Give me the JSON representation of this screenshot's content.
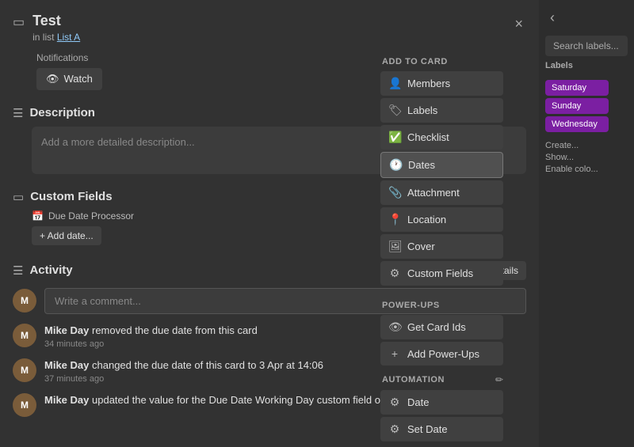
{
  "modal": {
    "title": "Test",
    "breadcrumb_prefix": "in list",
    "breadcrumb_link": "List A",
    "close_label": "×"
  },
  "notifications": {
    "label": "Notifications",
    "watch_label": "Watch"
  },
  "description": {
    "title": "Description",
    "placeholder": "Add a more detailed description..."
  },
  "custom_fields": {
    "title": "Custom Fields",
    "field_name": "Due Date Processor",
    "add_date_label": "+ Add date..."
  },
  "activity": {
    "title": "Activity",
    "hide_details_label": "Hide Details",
    "comment_placeholder": "Write a comment...",
    "items": [
      {
        "user": "Mike Day",
        "action": " removed the due date from this card",
        "time": "34 minutes ago"
      },
      {
        "user": "Mike Day",
        "action": " changed the due date of this card to 3 Apr at 14:06",
        "time": "37 minutes ago"
      },
      {
        "user": "Mike Day",
        "action": " updated the value for the Due Date Working Day custom field on this card",
        "time": ""
      }
    ]
  },
  "add_to_card": {
    "section_title": "Add to card",
    "buttons": [
      {
        "icon": "👤",
        "label": "Members"
      },
      {
        "icon": "🏷",
        "label": "Labels"
      },
      {
        "icon": "✅",
        "label": "Checklist"
      },
      {
        "icon": "📅",
        "label": "Dates",
        "active": true
      },
      {
        "icon": "📎",
        "label": "Attachment"
      },
      {
        "icon": "📍",
        "label": "Location"
      },
      {
        "icon": "🖼",
        "label": "Cover"
      },
      {
        "icon": "⚙",
        "label": "Custom Fields"
      }
    ]
  },
  "power_ups": {
    "section_title": "Power-Ups",
    "buttons": [
      {
        "icon": "👁",
        "label": "Get Card Ids"
      },
      {
        "icon": "+",
        "label": "Add Power-Ups"
      }
    ]
  },
  "automation": {
    "section_title": "Automation",
    "buttons": [
      {
        "icon": "⚙",
        "label": "Date"
      },
      {
        "icon": "⚙",
        "label": "Set Date"
      }
    ]
  },
  "right_panel": {
    "search_placeholder": "Search labels...",
    "labels_title": "Labels",
    "days": [
      "Saturday",
      "Sunday",
      "Wednesday"
    ],
    "actions": [
      "Create...",
      "Show...",
      "Enable colo..."
    ]
  }
}
